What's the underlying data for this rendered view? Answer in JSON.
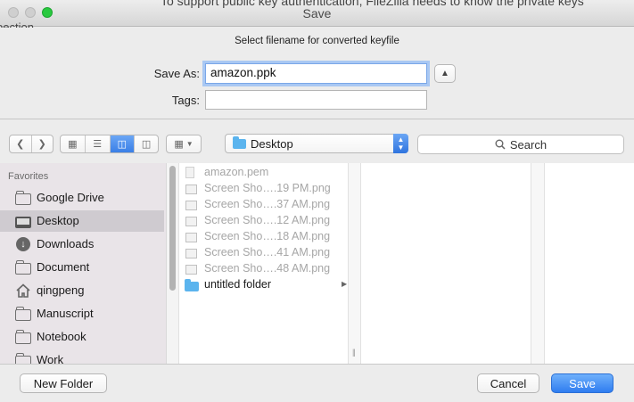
{
  "background_window": {
    "top_text": "To support public key authentication, FileZilla needs to know the private keys",
    "left_text": "pection"
  },
  "window": {
    "title": "Save"
  },
  "save_panel": {
    "prompt": "Select filename for converted keyfile",
    "save_as_label": "Save As:",
    "filename": "amazon.ppk",
    "tags_label": "Tags:",
    "tags_value": ""
  },
  "toolbar": {
    "location": "Desktop",
    "search_label": "Search"
  },
  "sidebar": {
    "heading": "Favorites",
    "items": [
      {
        "label": "Google Drive",
        "icon": "folder-icon"
      },
      {
        "label": "Desktop",
        "icon": "desktop-icon",
        "selected": true
      },
      {
        "label": "Downloads",
        "icon": "downloads-icon"
      },
      {
        "label": "Document",
        "icon": "folder-icon"
      },
      {
        "label": "qingpeng",
        "icon": "home-icon"
      },
      {
        "label": "Manuscript",
        "icon": "folder-icon"
      },
      {
        "label": "Notebook",
        "icon": "folder-icon"
      },
      {
        "label": "Work",
        "icon": "folder-icon"
      }
    ]
  },
  "files": [
    {
      "name": "amazon.pem",
      "type": "document",
      "enabled": false
    },
    {
      "name": "Screen Sho….19 PM.png",
      "type": "image",
      "enabled": false
    },
    {
      "name": "Screen Sho….37 AM.png",
      "type": "image",
      "enabled": false
    },
    {
      "name": "Screen Sho….12 AM.png",
      "type": "image",
      "enabled": false
    },
    {
      "name": "Screen Sho….18 AM.png",
      "type": "image",
      "enabled": false
    },
    {
      "name": "Screen Sho….41 AM.png",
      "type": "image",
      "enabled": false
    },
    {
      "name": "Screen Sho….48 AM.png",
      "type": "image",
      "enabled": false
    },
    {
      "name": "untitled folder",
      "type": "folder",
      "enabled": true
    }
  ],
  "buttons": {
    "new_folder": "New Folder",
    "cancel": "Cancel",
    "save": "Save"
  }
}
